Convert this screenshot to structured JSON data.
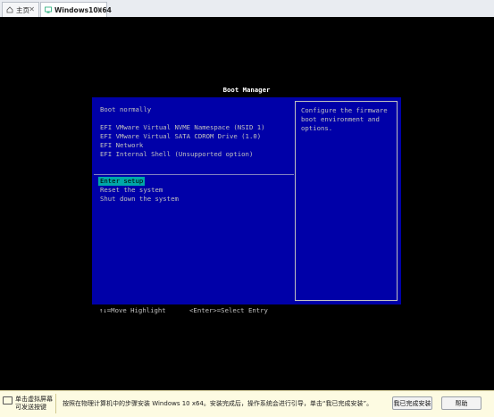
{
  "tabs": [
    {
      "label": "主页",
      "icon": "home-icon"
    },
    {
      "label": "Windows10x64",
      "icon": "vm-icon"
    }
  ],
  "bios": {
    "title": "Boot Manager",
    "entries_group1": [
      "Boot normally"
    ],
    "entries_group2": [
      "EFI VMware Virtual NVME Namespace (NSID 1)",
      "EFI VMware Virtual SATA CDROM Drive (1.0)",
      "EFI Network",
      "EFI Internal Shell (Unsupported option)"
    ],
    "selected_entry": "Enter setup",
    "entries_group3": [
      "Reset the system",
      "Shut down the system"
    ],
    "help_text": [
      "Configure the firmware",
      "boot environment and",
      "options."
    ],
    "footer": "↑↓=Move Highlight      <Enter>=Select Entry"
  },
  "infobar": {
    "left_line1": "单击虚拟屏幕",
    "left_line2": "可发送按键",
    "message": "按照在物理计算机中的步骤安装 Windows 10 x64。安装完成后，操作系统会进行引导，单击“我已完成安装”。",
    "done_button": "我已完成安装",
    "help_button": "帮助"
  },
  "colors": {
    "bios_bg": "#0000a8",
    "bios_text": "#c0c0c0",
    "highlight": "#00a8a8"
  }
}
